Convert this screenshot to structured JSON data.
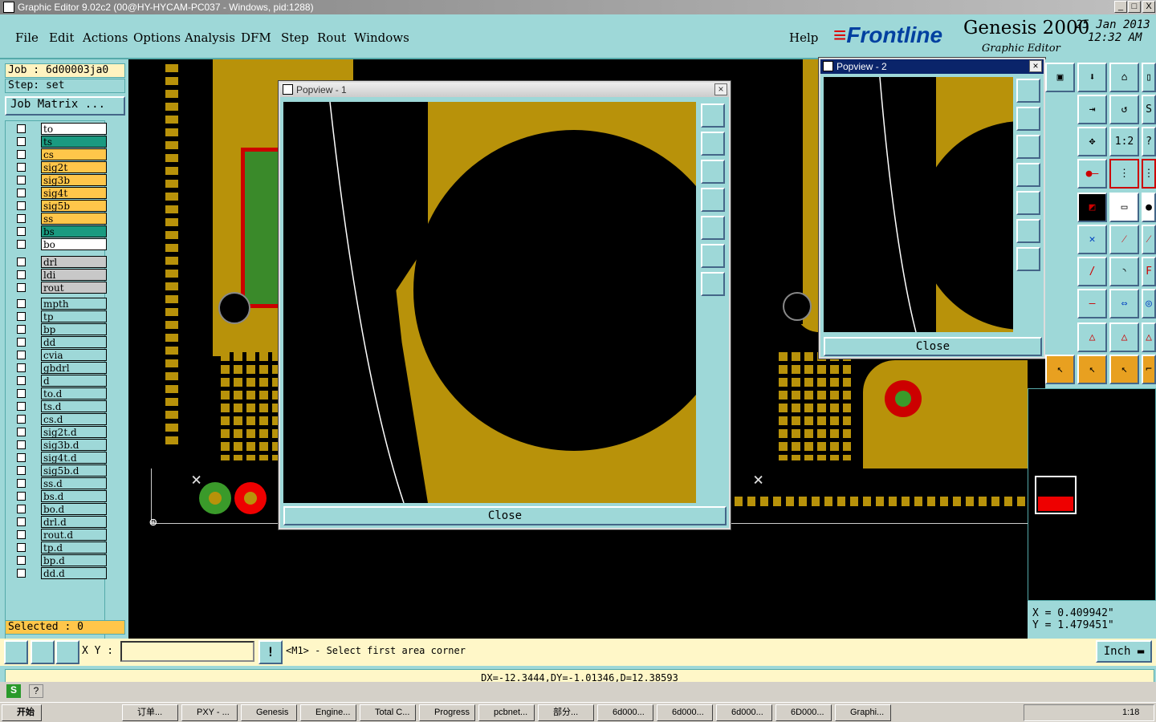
{
  "window": {
    "title": "Graphic Editor 9.02c2 (00@HY-HYCAM-PC037 - Windows, pid:1288)",
    "min": "_",
    "max": "□",
    "close": "X"
  },
  "menu": {
    "file": "File",
    "edit": "Edit",
    "actions": "Actions",
    "options": "Options",
    "analysis": "Analysis",
    "dfm": "DFM",
    "step": "Step",
    "rout": "Rout",
    "windows": "Windows",
    "help": "Help"
  },
  "brand": {
    "logo": "Frontline",
    "product": "Genesis 2000",
    "subtitle": "Graphic Editor",
    "date": "25 Jan 2013",
    "time": "12:32 AM"
  },
  "job": {
    "job": "Job : 6d00003ja0",
    "step": "Step: set",
    "matrix": "Job Matrix ..."
  },
  "layers": [
    {
      "name": "to",
      "color": "#ffffff"
    },
    {
      "name": "ts",
      "color": "#1a9a80"
    },
    {
      "name": "cs",
      "color": "#ffc64a"
    },
    {
      "name": "sig2t",
      "color": "#ffc64a"
    },
    {
      "name": "sig3b",
      "color": "#ffc64a"
    },
    {
      "name": "sig4t",
      "color": "#ffc64a"
    },
    {
      "name": "sig5b",
      "color": "#ffc64a"
    },
    {
      "name": "ss",
      "color": "#ffc64a"
    },
    {
      "name": "bs",
      "color": "#1a9a80"
    },
    {
      "name": "bo",
      "color": "#ffffff"
    }
  ],
  "layers2": [
    {
      "name": "drl"
    },
    {
      "name": "ldi"
    },
    {
      "name": "rout"
    }
  ],
  "layers3": [
    {
      "name": "mpth"
    },
    {
      "name": "tp"
    },
    {
      "name": "bp"
    },
    {
      "name": "dd"
    },
    {
      "name": "cvia"
    },
    {
      "name": "gbdrl"
    },
    {
      "name": "d"
    },
    {
      "name": "to.d"
    },
    {
      "name": "ts.d"
    },
    {
      "name": "cs.d"
    },
    {
      "name": "sig2t.d"
    },
    {
      "name": "sig3b.d"
    },
    {
      "name": "sig4t.d"
    },
    {
      "name": "sig5b.d"
    },
    {
      "name": "ss.d"
    },
    {
      "name": "bs.d"
    },
    {
      "name": "bo.d"
    },
    {
      "name": "drl.d"
    },
    {
      "name": "rout.d"
    },
    {
      "name": "tp.d"
    },
    {
      "name": "bp.d"
    },
    {
      "name": "dd.d"
    }
  ],
  "selected": "Selected : 0",
  "popview1": {
    "title": "Popview - 1",
    "close": "Close"
  },
  "popview2": {
    "title": "Popview - 2",
    "close": "Close"
  },
  "coords": {
    "x": "X = 0.409942\"",
    "y": "Y = 1.479451\""
  },
  "xy_label": "X Y :",
  "xy_value": "",
  "prompt": "<M1> - Select first area corner",
  "unit": "Inch",
  "status": "DX=-12.3444,DY=-1.01346,D=12.38593",
  "taskbar": {
    "start": "开始",
    "clock": "1:18",
    "tasks": [
      "订单...",
      "PXY - ...",
      "Genesis",
      "Engine...",
      "Total C...",
      "Progress",
      "pcbnet...",
      "部分...",
      "6d000...",
      "6d000...",
      "6d000...",
      "6D000...",
      "Graphi..."
    ]
  },
  "colors": {
    "panel": "#9ed8d8",
    "copper": "#b8920a",
    "bg": "#000000"
  }
}
